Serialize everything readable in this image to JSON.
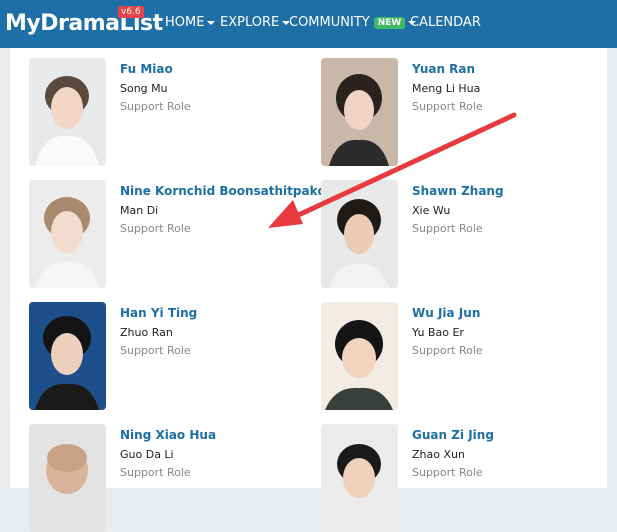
{
  "brand": {
    "logo": "MyDramaList",
    "version": "v6.6"
  },
  "nav": {
    "home": "HOME",
    "explore": "EXPLORE",
    "community": "COMMUNITY",
    "new_badge": "NEW",
    "calendar": "CALENDAR"
  },
  "cast": [
    {
      "name": "Fu Miao",
      "character": "Song Mu",
      "role": "Support Role"
    },
    {
      "name": "Yuan Ran",
      "character": "Meng Li Hua",
      "role": "Support Role"
    },
    {
      "name": "Nine Kornchid Boonsathitpakdee",
      "character": "Man Di",
      "role": "Support Role"
    },
    {
      "name": "Shawn Zhang",
      "character": "Xie Wu",
      "role": "Support Role"
    },
    {
      "name": "Han Yi Ting",
      "character": "Zhuo Ran",
      "role": "Support Role"
    },
    {
      "name": "Wu Jia Jun",
      "character": "Yu Bao Er",
      "role": "Support Role"
    },
    {
      "name": "Ning Xiao Hua",
      "character": "Guo Da Li",
      "role": "Support Role"
    },
    {
      "name": "Guan Zi Jing",
      "character": "Zhao Xun",
      "role": "Support Role"
    }
  ],
  "colors": {
    "nav_bg": "#1d6fa5",
    "link": "#1d6fa5",
    "new_badge": "#41b862",
    "version_badge": "#e6434a",
    "annotation_arrow": "#e8393f"
  }
}
